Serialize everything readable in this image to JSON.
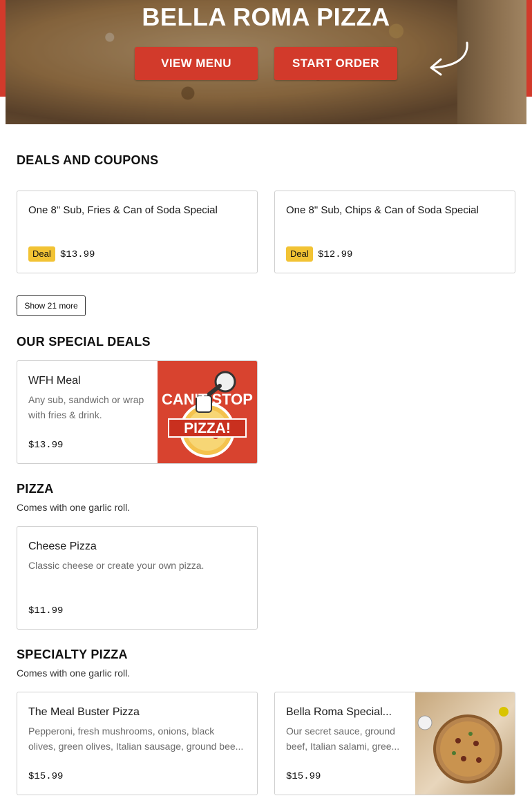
{
  "hero": {
    "title": "BELLA ROMA PIZZA",
    "view_menu_label": "VIEW MENU",
    "start_order_label": "START ORDER",
    "accent": "#d23a2b"
  },
  "deals": {
    "title": "DEALS AND COUPONS",
    "items": [
      {
        "name": "One 8\" Sub, Fries & Can of Soda Special",
        "badge": "Deal",
        "price": "$13.99"
      },
      {
        "name": "One 8\" Sub, Chips & Can of Soda Special",
        "badge": "Deal",
        "price": "$12.99"
      }
    ],
    "show_more_label": "Show 21 more"
  },
  "special_deals": {
    "title": "OUR SPECIAL DEALS",
    "items": [
      {
        "name": "WFH Meal",
        "desc": "Any sub, sandwich or wrap with fries & drink.",
        "price": "$13.99",
        "image_text_1": "CAN'T STOP",
        "image_text_2": "PIZZA!"
      }
    ]
  },
  "pizza": {
    "title": "PIZZA",
    "subtitle": "Comes with one garlic roll.",
    "items": [
      {
        "name": "Cheese Pizza",
        "desc": "Classic cheese or create your own pizza.",
        "price": "$11.99"
      }
    ]
  },
  "specialty_pizza": {
    "title": "SPECIALTY PIZZA",
    "subtitle": "Comes with one garlic roll.",
    "items": [
      {
        "name": "The Meal Buster Pizza",
        "desc_line1": "Pepperoni, fresh mushrooms, onions, black",
        "desc_line2": "olives, green olives, Italian sausage, ground bee...",
        "price": "$15.99"
      },
      {
        "name": "Bella Roma Special...",
        "desc_line1": "Our secret sauce, ground",
        "desc_line2": "beef, Italian salami, gree...",
        "price": "$15.99"
      }
    ]
  },
  "colors": {
    "badge": "#f2c334",
    "border": "#cfcfcf",
    "muted_text": "#6b6b6b"
  }
}
